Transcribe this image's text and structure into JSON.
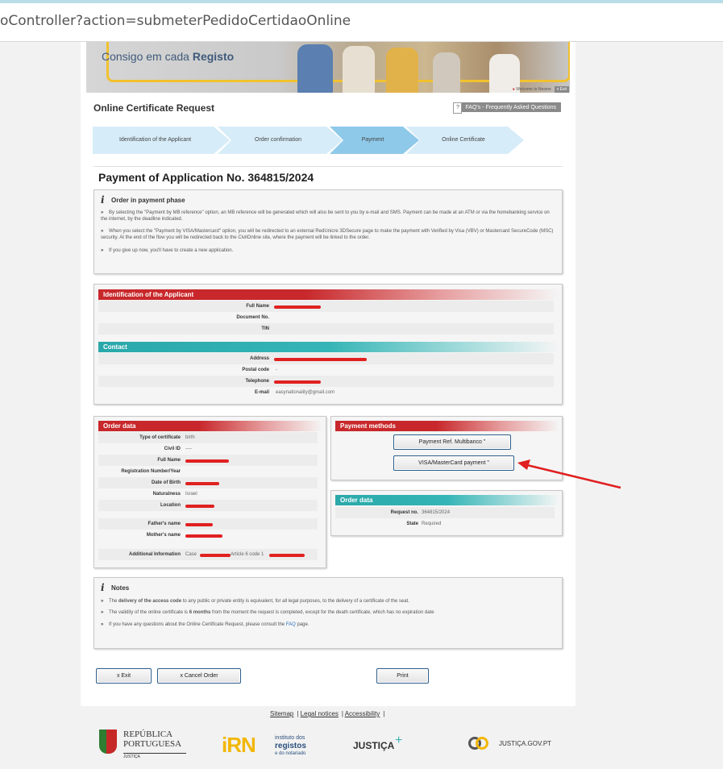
{
  "browser": {
    "url": "oController?action=submeterPedidoCertidaoOnline"
  },
  "banner": {
    "slogan_prefix": "Consigo em cada ",
    "slogan_bold": "Registo",
    "welcome": "Welcome to Nesme",
    "exit": "x Exit"
  },
  "header": {
    "title": "Online Certificate Request",
    "faq_q": "?",
    "faq": "FAQ's - Frequently Asked Questions"
  },
  "steps": [
    "Identification of the Applicant",
    "Order confirmation",
    "Payment",
    "Online Certificate"
  ],
  "colors": {
    "step_inactive": "#d6ecf8",
    "step_active": "#8fc9ea",
    "red": "#c8282b",
    "teal": "#2aa8aa",
    "button_border": "#2d5d8a",
    "arrow": "#e02020"
  },
  "page_title": "Payment of Application No. 364815/2024",
  "info": {
    "heading": "Order in payment phase",
    "bullets": [
      "By selecting the \"Payment by MB reference\" option, an MB reference will be generated which will also be sent to you by e-mail and SMS. Payment can be made at an ATM or via the homebanking service on the internet, by the deadline indicated.",
      "When you select the \"Payment by VISA/Mastercard\" option, you will be redirected to an external RedUnicre 3DSecure page to make the payment with Verified by Visa (VBV) or Mastercard SecureCode (MSC) security. At the end of the flow you will be redirected back to the CivilOnline site, where the payment will be linked to the order.",
      "If you give up now, you'll have to create a new application."
    ]
  },
  "applicant": {
    "section": "Identification of the Applicant",
    "full_name_label": "Full Name",
    "document_label": "Document No.",
    "tin_label": "TIN",
    "contact_section": "Contact",
    "address_label": "Address",
    "postal_label": "Postal code",
    "postal_value": "-",
    "telephone_label": "Telephone",
    "email_label": "E-mail",
    "email_value": "easynationality@gmail.com"
  },
  "order": {
    "section": "Order data",
    "type_label": "Type of certificate",
    "type_value": "birth",
    "civil_label": "Civil ID",
    "civil_value": "----",
    "full_name_label": "Full Name",
    "registration_label": "Registration Number/Year",
    "dob_label": "Date of Birth",
    "naturalness_label": "Naturalness",
    "naturalness_value": "Israel",
    "location_label": "Location",
    "father_label": "Father's name",
    "mother_label": "Mother's name",
    "additional_label": "Additional Information",
    "additional_value_a": "Case",
    "additional_value_b": "Article 6 code 1"
  },
  "payment": {
    "section": "Payment methods",
    "mb_button": "Payment Ref. Multibanco \"",
    "visa_button": "VISA/MasterCard payment \""
  },
  "order_summary": {
    "section": "Order data",
    "request_label": "Request no.",
    "request_value": "364815/2024",
    "state_label": "State",
    "state_value": "Required"
  },
  "notes": {
    "heading": "Notes",
    "n1_pre": "The ",
    "n1_bold": "delivery of the access code",
    "n1_post": " to any public or private entity is equivalent, for all legal purposes, to the delivery of a certificate of the seat.",
    "n2_pre": "The validity of the online certificate is ",
    "n2_bold": "6 months",
    "n2_post": " from the moment the request is completed, except for the death certificate, which has no expiration date",
    "n3_pre": "If you have any questions about the Online Certificate Request, please consult the ",
    "n3_link": "FAQ",
    "n3_post": " page."
  },
  "actions": {
    "exit": "x Exit",
    "cancel": "x Cancel Order",
    "print": "Print"
  },
  "footer": {
    "sitemap": "Sitemap",
    "legal": "Legal notices",
    "accessibility": "Accessibility",
    "logo1_a": "REPÚBLICA",
    "logo1_b": "PORTUGUESA",
    "logo1_c": "JUSTIÇA",
    "logo2_mark": "iRN",
    "logo2_a": "instituto dos",
    "logo2_b": "registos",
    "logo2_c": "e do notariado",
    "logo3": "JUSTIÇA",
    "logo4": "JUSTIÇA.GOV.PT"
  }
}
